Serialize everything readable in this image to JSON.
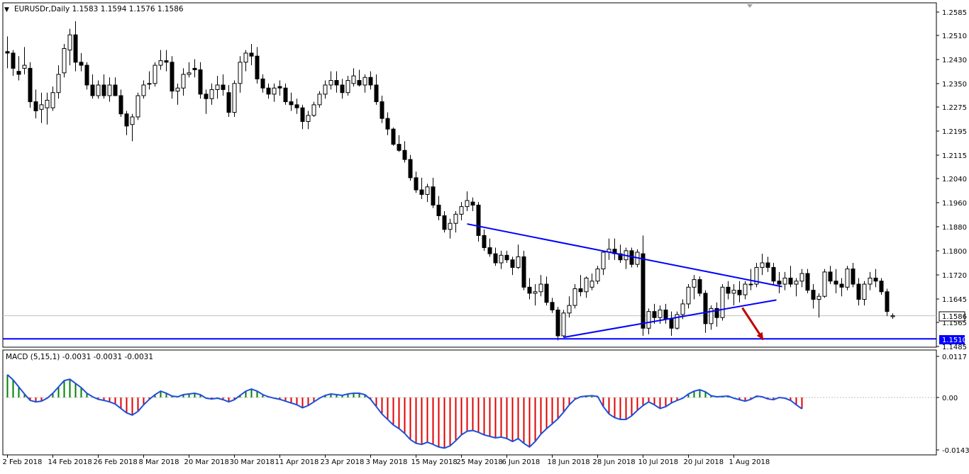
{
  "colors": {
    "background": "#ffffff",
    "frame": "#000000",
    "candle": "#000000",
    "trend_line": "#0000ff",
    "support_line": "#0000ff",
    "price_label_fill": "#0000ff",
    "current_label_fill": "#ffffff",
    "current_line": "#c0c0c0",
    "macd_line": "#1e50dc",
    "hist_positive": "#008000",
    "hist_negative": "#e00000",
    "arrow": "#c00000"
  },
  "main_panel": {
    "header": "EURUSDr,Daily  1.1583 1.1594 1.1576 1.1586",
    "current_price": "1.1586",
    "support_label": "1.1510"
  },
  "macd_panel": {
    "header": "MACD (5,15,1) -0.0031 -0.0031 -0.0031"
  },
  "chart_data": [
    {
      "type": "candlestick",
      "symbol": "EURUSDr",
      "timeframe": "Daily",
      "y_ticks": [
        "1.2585",
        "1.2510",
        "1.2430",
        "1.2350",
        "1.2275",
        "1.2195",
        "1.2115",
        "1.2040",
        "1.1960",
        "1.1880",
        "1.1800",
        "1.1720",
        "1.1645",
        "1.1565",
        "1.1485"
      ],
      "ylim": [
        1.1485,
        1.2585
      ],
      "x_tick_labels": [
        "2 Feb 2018",
        "14 Feb 2018",
        "26 Feb 2018",
        "8 Mar 2018",
        "20 Mar 2018",
        "30 Mar 2018",
        "11 Apr 2018",
        "23 Apr 2018",
        "3 May 2018",
        "15 May 2018",
        "25 May 2018",
        "6 Jun 2018",
        "18 Jun 2018",
        "28 Jun 2018",
        "10 Jul 2018",
        "20 Jul 2018",
        "1 Aug 2018"
      ],
      "x_tick_index": [
        0,
        8,
        16,
        24,
        32,
        40,
        48,
        56,
        64,
        72,
        80,
        88,
        96,
        104,
        112,
        120,
        128
      ],
      "ohlc": [
        [
          1.2455,
          1.2505,
          1.24,
          1.245
        ],
        [
          1.245,
          1.246,
          1.2375,
          1.24
        ],
        [
          1.239,
          1.244,
          1.236,
          1.238
        ],
        [
          1.24,
          1.247,
          1.238,
          1.241
        ],
        [
          1.24,
          1.242,
          1.227,
          1.229
        ],
        [
          1.229,
          1.233,
          1.2235,
          1.226
        ],
        [
          1.2265,
          1.232,
          1.222,
          1.228
        ],
        [
          1.227,
          1.232,
          1.2215,
          1.2295
        ],
        [
          1.227,
          1.234,
          1.226,
          1.232
        ],
        [
          1.232,
          1.241,
          1.23,
          1.238
        ],
        [
          1.2385,
          1.248,
          1.237,
          1.2465
        ],
        [
          1.246,
          1.253,
          1.241,
          1.251
        ],
        [
          1.251,
          1.2555,
          1.239,
          1.242
        ],
        [
          1.242,
          1.245,
          1.239,
          1.241
        ],
        [
          1.241,
          1.242,
          1.233,
          1.2345
        ],
        [
          1.2345,
          1.238,
          1.23,
          1.231
        ],
        [
          1.231,
          1.236,
          1.23,
          1.2345
        ],
        [
          1.2345,
          1.238,
          1.23,
          1.231
        ],
        [
          1.231,
          1.237,
          1.229,
          1.2345
        ],
        [
          1.2345,
          1.237,
          1.231,
          1.231
        ],
        [
          1.231,
          1.233,
          1.224,
          1.225
        ],
        [
          1.225,
          1.226,
          1.218,
          1.221
        ],
        [
          1.2215,
          1.225,
          1.216,
          1.224
        ],
        [
          1.224,
          1.232,
          1.223,
          1.231
        ],
        [
          1.231,
          1.236,
          1.23,
          1.2345
        ],
        [
          1.235,
          1.239,
          1.233,
          1.235
        ],
        [
          1.235,
          1.242,
          1.234,
          1.241
        ],
        [
          1.241,
          1.246,
          1.2395,
          1.2425
        ],
        [
          1.2425,
          1.246,
          1.239,
          1.242
        ],
        [
          1.242,
          1.244,
          1.23,
          1.2325
        ],
        [
          1.2325,
          1.235,
          1.228,
          1.2335
        ],
        [
          1.2335,
          1.24,
          1.231,
          1.238
        ],
        [
          1.238,
          1.242,
          1.237,
          1.2385
        ],
        [
          1.24,
          1.243,
          1.237,
          1.2395
        ],
        [
          1.2395,
          1.242,
          1.23,
          1.2315
        ],
        [
          1.2315,
          1.233,
          1.225,
          1.23
        ],
        [
          1.23,
          1.235,
          1.228,
          1.233
        ],
        [
          1.233,
          1.2375,
          1.23,
          1.2345
        ],
        [
          1.2345,
          1.238,
          1.231,
          1.233
        ],
        [
          1.232,
          1.2345,
          1.224,
          1.2255
        ],
        [
          1.2255,
          1.236,
          1.224,
          1.235
        ],
        [
          1.235,
          1.244,
          1.232,
          1.242
        ],
        [
          1.242,
          1.246,
          1.239,
          1.245
        ],
        [
          1.245,
          1.248,
          1.241,
          1.244
        ],
        [
          1.244,
          1.247,
          1.235,
          1.2365
        ],
        [
          1.2365,
          1.238,
          1.232,
          1.2335
        ],
        [
          1.2335,
          1.235,
          1.23,
          1.2315
        ],
        [
          1.2315,
          1.235,
          1.229,
          1.2335
        ],
        [
          1.234,
          1.236,
          1.231,
          1.2335
        ],
        [
          1.2335,
          1.235,
          1.228,
          1.229
        ],
        [
          1.229,
          1.232,
          1.226,
          1.228
        ],
        [
          1.228,
          1.23,
          1.225,
          1.227
        ],
        [
          1.227,
          1.228,
          1.22,
          1.2225
        ],
        [
          1.2225,
          1.226,
          1.22,
          1.2245
        ],
        [
          1.2245,
          1.229,
          1.224,
          1.228
        ],
        [
          1.228,
          1.2325,
          1.227,
          1.2315
        ],
        [
          1.2315,
          1.236,
          1.23,
          1.2345
        ],
        [
          1.2345,
          1.239,
          1.233,
          1.236
        ],
        [
          1.236,
          1.239,
          1.232,
          1.2345
        ],
        [
          1.2345,
          1.2365,
          1.23,
          1.232
        ],
        [
          1.232,
          1.2375,
          1.231,
          1.236
        ],
        [
          1.235,
          1.24,
          1.234,
          1.2375
        ],
        [
          1.236,
          1.2395,
          1.234,
          1.2345
        ],
        [
          1.2345,
          1.238,
          1.232,
          1.237
        ],
        [
          1.237,
          1.239,
          1.233,
          1.2345
        ],
        [
          1.2345,
          1.238,
          1.228,
          1.229
        ],
        [
          1.229,
          1.231,
          1.222,
          1.2235
        ],
        [
          1.2235,
          1.2255,
          1.218,
          1.22
        ],
        [
          1.22,
          1.2205,
          1.2145,
          1.215
        ],
        [
          1.215,
          1.218,
          1.2125,
          1.213
        ],
        [
          1.213,
          1.216,
          1.209,
          1.21
        ],
        [
          1.21,
          1.2115,
          1.203,
          1.204
        ],
        [
          1.204,
          1.206,
          1.199,
          1.2
        ],
        [
          1.2,
          1.204,
          1.197,
          1.1985
        ],
        [
          1.1985,
          1.202,
          1.196,
          1.201
        ],
        [
          1.201,
          1.204,
          1.194,
          1.195
        ],
        [
          1.195,
          1.198,
          1.19,
          1.1915
        ],
        [
          1.1915,
          1.193,
          1.186,
          1.187
        ],
        [
          1.187,
          1.1905,
          1.184,
          1.189
        ],
        [
          1.189,
          1.193,
          1.186,
          1.192
        ],
        [
          1.192,
          1.196,
          1.19,
          1.1945
        ],
        [
          1.1945,
          1.1995,
          1.193,
          1.1965
        ],
        [
          1.196,
          1.1975,
          1.193,
          1.195
        ],
        [
          1.195,
          1.196,
          1.183,
          1.185
        ],
        [
          1.185,
          1.187,
          1.18,
          1.181
        ],
        [
          1.181,
          1.184,
          1.178,
          1.179
        ],
        [
          1.179,
          1.181,
          1.175,
          1.176
        ],
        [
          1.176,
          1.18,
          1.174,
          1.1785
        ],
        [
          1.1785,
          1.18,
          1.176,
          1.177
        ],
        [
          1.177,
          1.178,
          1.172,
          1.1745
        ],
        [
          1.1745,
          1.182,
          1.174,
          1.178
        ],
        [
          1.178,
          1.18,
          1.167,
          1.168
        ],
        [
          1.168,
          1.171,
          1.164,
          1.166
        ],
        [
          1.166,
          1.169,
          1.162,
          1.1665
        ],
        [
          1.1665,
          1.172,
          1.165,
          1.169
        ],
        [
          1.169,
          1.1715,
          1.162,
          1.163
        ],
        [
          1.163,
          1.1645,
          1.1595,
          1.1605
        ],
        [
          1.1605,
          1.1615,
          1.1505,
          1.152
        ],
        [
          1.152,
          1.1605,
          1.1515,
          1.1595
        ],
        [
          1.1595,
          1.165,
          1.158,
          1.162
        ],
        [
          1.162,
          1.169,
          1.161,
          1.1675
        ],
        [
          1.1675,
          1.172,
          1.165,
          1.1665
        ],
        [
          1.1665,
          1.1715,
          1.1645,
          1.171
        ],
        [
          1.168,
          1.1725,
          1.167,
          1.17
        ],
        [
          1.17,
          1.175,
          1.169,
          1.174
        ],
        [
          1.174,
          1.18,
          1.172,
          1.1795
        ],
        [
          1.1795,
          1.184,
          1.177,
          1.1805
        ],
        [
          1.1805,
          1.184,
          1.177,
          1.179
        ],
        [
          1.179,
          1.182,
          1.176,
          1.177
        ],
        [
          1.177,
          1.181,
          1.174,
          1.18
        ],
        [
          1.18,
          1.181,
          1.1745,
          1.1755
        ],
        [
          1.1755,
          1.1805,
          1.1745,
          1.1795
        ],
        [
          1.179,
          1.185,
          1.152,
          1.1545
        ],
        [
          1.1545,
          1.161,
          1.1525,
          1.16
        ],
        [
          1.16,
          1.1625,
          1.156,
          1.158
        ],
        [
          1.158,
          1.162,
          1.156,
          1.1605
        ],
        [
          1.1605,
          1.1625,
          1.156,
          1.1575
        ],
        [
          1.1575,
          1.16,
          1.152,
          1.1545
        ],
        [
          1.1545,
          1.16,
          1.154,
          1.159
        ],
        [
          1.159,
          1.164,
          1.1575,
          1.1625
        ],
        [
          1.1625,
          1.169,
          1.161,
          1.168
        ],
        [
          1.168,
          1.172,
          1.164,
          1.1705
        ],
        [
          1.1705,
          1.1715,
          1.165,
          1.166
        ],
        [
          1.166,
          1.167,
          1.153,
          1.156
        ],
        [
          1.156,
          1.162,
          1.154,
          1.161
        ],
        [
          1.161,
          1.163,
          1.155,
          1.158
        ],
        [
          1.158,
          1.169,
          1.157,
          1.168
        ],
        [
          1.168,
          1.17,
          1.164,
          1.166
        ],
        [
          1.166,
          1.169,
          1.162,
          1.167
        ],
        [
          1.167,
          1.17,
          1.163,
          1.1655
        ],
        [
          1.1655,
          1.17,
          1.164,
          1.169
        ],
        [
          1.169,
          1.174,
          1.167,
          1.169
        ],
        [
          1.169,
          1.176,
          1.168,
          1.1745
        ],
        [
          1.1745,
          1.179,
          1.172,
          1.176
        ],
        [
          1.176,
          1.178,
          1.173,
          1.1745
        ],
        [
          1.1745,
          1.176,
          1.169,
          1.17
        ],
        [
          1.17,
          1.173,
          1.166,
          1.169
        ],
        [
          1.169,
          1.173,
          1.167,
          1.171
        ],
        [
          1.171,
          1.175,
          1.168,
          1.169
        ],
        [
          1.169,
          1.171,
          1.165,
          1.17
        ],
        [
          1.17,
          1.174,
          1.168,
          1.1725
        ],
        [
          1.1725,
          1.174,
          1.166,
          1.167
        ],
        [
          1.167,
          1.169,
          1.161,
          1.164
        ],
        [
          1.164,
          1.166,
          1.158,
          1.165
        ],
        [
          1.165,
          1.174,
          1.1645,
          1.173
        ],
        [
          1.173,
          1.175,
          1.169,
          1.17
        ],
        [
          1.17,
          1.174,
          1.166,
          1.169
        ],
        [
          1.169,
          1.171,
          1.165,
          1.168
        ],
        [
          1.168,
          1.175,
          1.167,
          1.174
        ],
        [
          1.174,
          1.176,
          1.168,
          1.169
        ],
        [
          1.169,
          1.171,
          1.162,
          1.164
        ],
        [
          1.164,
          1.17,
          1.162,
          1.169
        ],
        [
          1.169,
          1.173,
          1.167,
          1.171
        ],
        [
          1.171,
          1.174,
          1.168,
          1.17
        ],
        [
          1.17,
          1.171,
          1.1655,
          1.1665
        ],
        [
          1.1665,
          1.1675,
          1.1585,
          1.16
        ],
        [
          1.1583,
          1.1594,
          1.1576,
          1.1586
        ]
      ],
      "trend_lines": [
        {
          "name": "upper-resistance",
          "x": [
            81,
            136.5
          ],
          "y": [
            1.1888,
            1.1682
          ]
        },
        {
          "name": "lower-support",
          "x": [
            98,
            135.5
          ],
          "y": [
            1.1515,
            1.1638
          ]
        }
      ],
      "horizontal_line": {
        "y": 1.151,
        "label": "1.1510"
      },
      "arrow": {
        "x": [
          129.5,
          133.2
        ],
        "y": [
          1.1612,
          1.1507
        ]
      }
    },
    {
      "type": "bar",
      "name": "MACD (5,15,1)",
      "y_ticks": [
        "0.0117",
        "0.00",
        "-0.0143"
      ],
      "ylim": [
        -0.0143,
        0.0117
      ],
      "values": [
        0.0065,
        0.005,
        0.003,
        0.001,
        -0.0008,
        -0.0012,
        -0.001,
        -0.0002,
        0.0012,
        0.003,
        0.0048,
        0.0052,
        0.004,
        0.0028,
        0.0012,
        0.0002,
        -0.0005,
        -0.0008,
        -0.0012,
        -0.0018,
        -0.003,
        -0.0042,
        -0.0048,
        -0.0038,
        -0.002,
        -0.0005,
        0.0008,
        0.0018,
        0.0012,
        0.0004,
        0.0002,
        0.0008,
        0.001,
        0.0012,
        0.0008,
        -0.0002,
        -0.0004,
        -0.0002,
        -0.0006,
        -0.0012,
        -0.0006,
        0.0006,
        0.0018,
        0.0024,
        0.0018,
        0.0008,
        0.0002,
        -0.0002,
        -0.0005,
        -0.001,
        -0.0015,
        -0.002,
        -0.0028,
        -0.0022,
        -0.0012,
        -0.0002,
        0.0006,
        0.001,
        0.0008,
        0.0006,
        0.001,
        0.0012,
        0.0012,
        0.0008,
        -0.0005,
        -0.0025,
        -0.0045,
        -0.006,
        -0.0075,
        -0.0085,
        -0.0098,
        -0.0115,
        -0.0125,
        -0.0128,
        -0.0122,
        -0.0128,
        -0.0135,
        -0.0138,
        -0.0132,
        -0.0118,
        -0.0102,
        -0.0092,
        -0.009,
        -0.0095,
        -0.0102,
        -0.0106,
        -0.011,
        -0.0108,
        -0.0112,
        -0.012,
        -0.0112,
        -0.0125,
        -0.0135,
        -0.012,
        -0.01,
        -0.0085,
        -0.0072,
        -0.0058,
        -0.004,
        -0.002,
        -0.0005,
        0.0002,
        0.0004,
        0.0005,
        0.0003,
        -0.0025,
        -0.0045,
        -0.0055,
        -0.006,
        -0.006,
        -0.005,
        -0.0035,
        -0.0022,
        -0.0012,
        -0.002,
        -0.003,
        -0.0025,
        -0.0015,
        -0.0008,
        -0.0002,
        0.001,
        0.0018,
        0.0022,
        0.0016,
        0.0005,
        0.0002,
        0.0003,
        0.0004,
        -0.0002,
        -0.0006,
        -0.001,
        -0.0005,
        0.0004,
        0.0002,
        -0.0004,
        -0.0006,
        0.0,
        -0.0002,
        -0.0008,
        -0.002,
        -0.0031
      ],
      "signal_line_same_as_macd": true
    }
  ]
}
